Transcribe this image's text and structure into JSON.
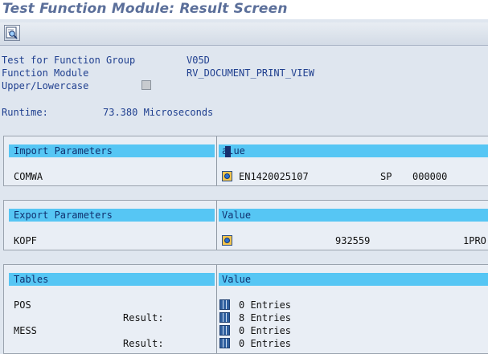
{
  "window": {
    "title": "Test Function Module: Result Screen"
  },
  "toolbar": {
    "icon": "search-icon"
  },
  "header_fields": {
    "group_label": "Test for Function Group",
    "group_value": "V05D",
    "module_label": "Function Module",
    "module_value": "RV_DOCUMENT_PRINT_VIEW",
    "case_label": "Upper/Lowercase",
    "case_checked": false
  },
  "runtime": {
    "label": "Runtime:",
    "value": "73.380 Microseconds"
  },
  "import_section": {
    "header": "Import Parameters",
    "value_header": "Value",
    "rows": [
      {
        "name": "COMWA",
        "col1": "EN1420025107",
        "col2": "SP",
        "col3": "000000"
      }
    ]
  },
  "export_section": {
    "header": "Export Parameters",
    "value_header": "Value",
    "rows": [
      {
        "name": "KOPF",
        "col1": "932559",
        "col2": "1PRO"
      }
    ]
  },
  "tables_section": {
    "header": "Tables",
    "value_header": "Value",
    "rows": [
      {
        "name": "POS",
        "entries": "0 Entries"
      },
      {
        "name": "Result:",
        "entries": "8 Entries"
      },
      {
        "name": "MESS",
        "entries": "0 Entries"
      },
      {
        "name": "Result:",
        "entries": "0 Entries"
      }
    ]
  },
  "colors": {
    "header_bg": "#56c6f4",
    "label_text": "#1f3f8f",
    "title_text": "#5b6f9a"
  }
}
